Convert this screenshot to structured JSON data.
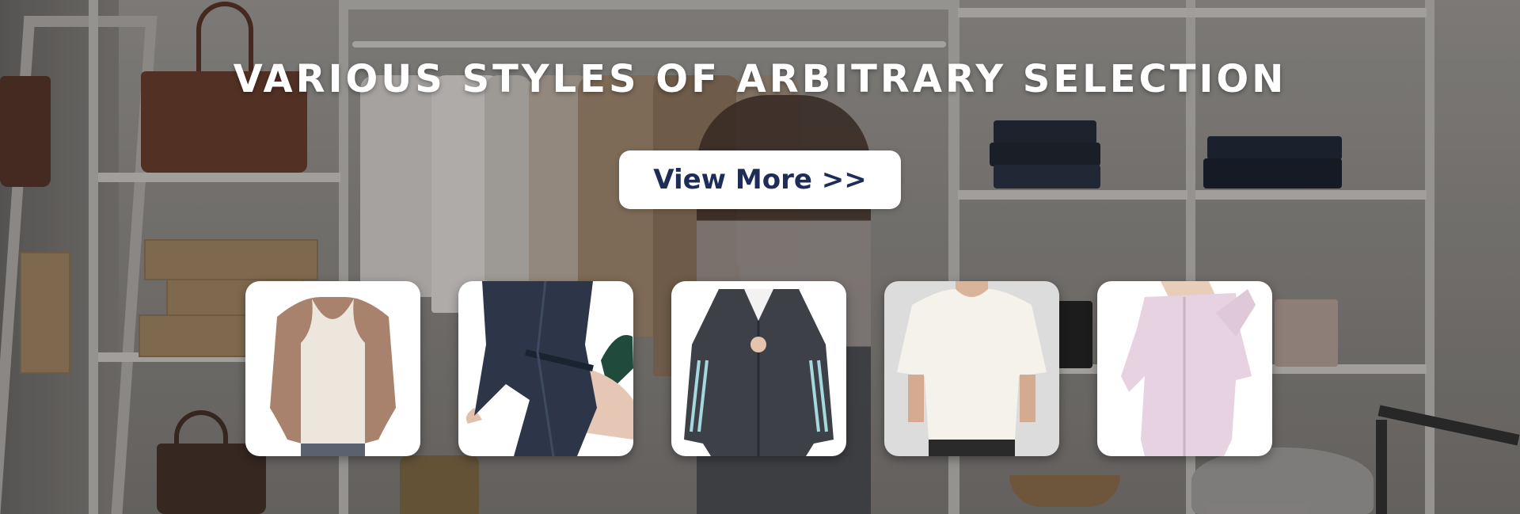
{
  "banner": {
    "headline": "VARIOUS STYLES OF ARBITRARY SELECTION",
    "cta_label": "View More >>",
    "accent_color": "#1e2d57"
  },
  "products": [
    {
      "name": "white tank top",
      "icon": "tank-top-image"
    },
    {
      "name": "navy satin robe",
      "icon": "robe-image"
    },
    {
      "name": "striped zip hoodie",
      "icon": "hoodie-image"
    },
    {
      "name": "oversized white t-shirt",
      "icon": "tshirt-image"
    },
    {
      "name": "pink zip jacket",
      "icon": "jacket-image"
    }
  ]
}
